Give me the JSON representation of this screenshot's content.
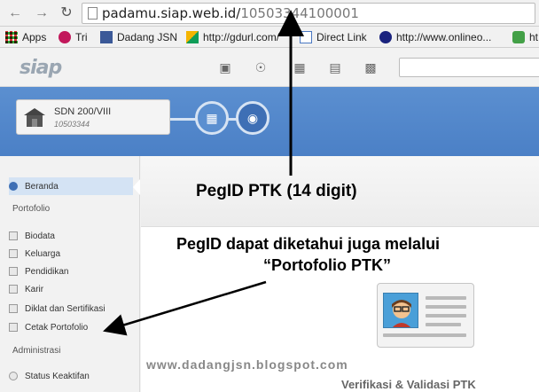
{
  "browser": {
    "url_host": "padamu.siap.web.id/",
    "url_path": "10503344100001",
    "back_glyph": "←",
    "forward_glyph": "→",
    "reload_glyph": "↻",
    "bookmarks": [
      {
        "label": "Apps",
        "icon": "apps-grid-icon"
      },
      {
        "label": "Tri",
        "icon": "tri-logo-icon"
      },
      {
        "label": "Dadang JSN",
        "icon": "user-avatar-icon"
      },
      {
        "label": "http://gdurl.com/",
        "icon": "gdurl-icon"
      },
      {
        "label": "Direct Link",
        "icon": "page-icon"
      },
      {
        "label": "http://www.onlineo...",
        "icon": "shield-icon"
      },
      {
        "label": "ht",
        "icon": "refresh-green-icon"
      }
    ]
  },
  "app": {
    "logo": "siap",
    "header_icons": [
      "cube-icon",
      "rss-icon",
      "grid-icon",
      "list-icon",
      "id-card-icon"
    ]
  },
  "school": {
    "name": "SDN 200/VIII",
    "npsn": "10503344"
  },
  "sidebar": {
    "items_top": [
      {
        "label": "Beranda",
        "active": true
      }
    ],
    "sections": [
      {
        "title": "Portofolio",
        "items": [
          "Biodata",
          "Keluarga",
          "Pendidikan",
          "Karir",
          "Diklat dan Sertifikasi",
          "Cetak Portofolio"
        ]
      },
      {
        "title": "Administrasi",
        "items": [
          "Status Keaktifan"
        ]
      }
    ]
  },
  "annotations": {
    "pegid_label": "PegID PTK (14 digit)",
    "line1": "PegID dapat diketahui juga melalui",
    "line2": "“Portofolio PTK”"
  },
  "footer": {
    "watermark": "www.dadangjsn.blogspot.com",
    "subtitle": "Verifikasi & Validasi PTK"
  },
  "colors": {
    "band": "#4b80c6",
    "active_bg": "#d4e3f4",
    "annotation_text": "#000000"
  }
}
